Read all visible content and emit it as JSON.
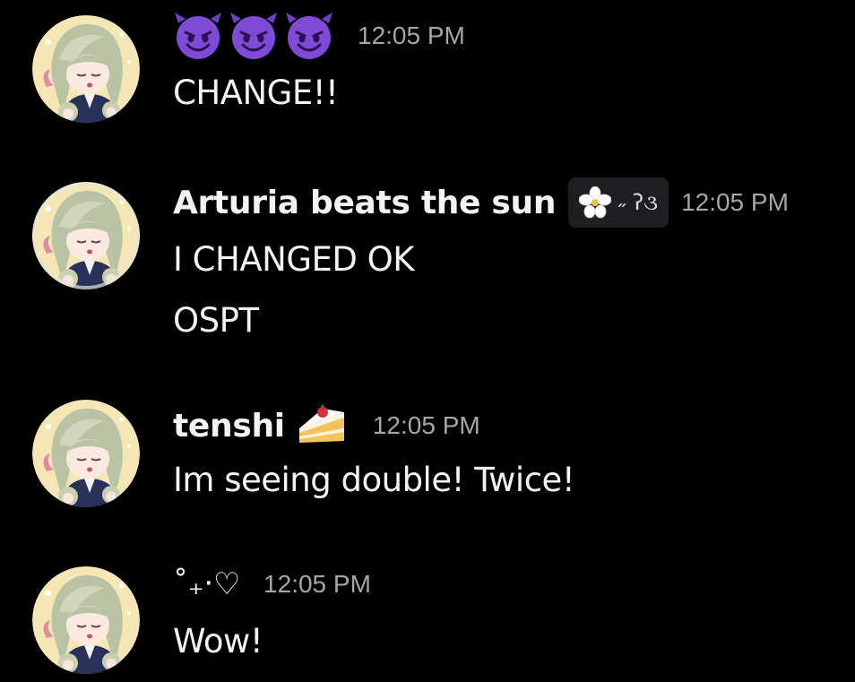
{
  "colors": {
    "background": "#000000",
    "text": "#f2f3f5",
    "timestamp": "#a3a6aa",
    "tag_bg": "#1e1f22",
    "devil": "#6d3fc4"
  },
  "messages": [
    {
      "avatar_icon": "anime-avatar",
      "reactions_icons": [
        "smiling-devil-emoji",
        "smiling-devil-emoji",
        "smiling-devil-emoji"
      ],
      "time": "12:05 PM",
      "lines": [
        "CHANGE!!"
      ]
    },
    {
      "avatar_icon": "anime-avatar-moon",
      "name": "Arturia beats the sun",
      "tag_icon": "white-flower-icon",
      "tag_text": "˶ ʔ૩",
      "time": "12:05 PM",
      "lines": [
        "I CHANGED OK",
        "OSPT"
      ]
    },
    {
      "avatar_icon": "anime-avatar",
      "name": "tenshi",
      "name_icon": "cake-slice-emoji",
      "time": "12:05 PM",
      "lines": [
        "Im seeing double! Twice!"
      ]
    },
    {
      "avatar_icon": "anime-avatar",
      "name": "˚₊‧♡",
      "time": "12:05 PM",
      "lines": [
        "Wow!"
      ]
    }
  ]
}
